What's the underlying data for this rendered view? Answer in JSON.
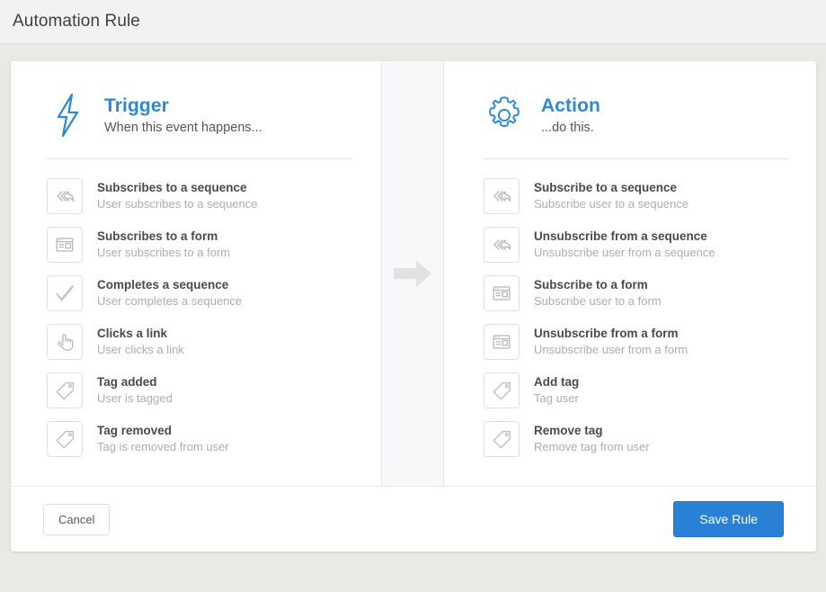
{
  "header": {
    "title": "Automation Rule"
  },
  "trigger": {
    "icon": "lightning-bolt-icon",
    "title": "Trigger",
    "subtitle": "When this event happens...",
    "options": [
      {
        "icon": "sequence-icon",
        "title": "Subscribes to a sequence",
        "subtitle": "User subscribes to a sequence"
      },
      {
        "icon": "form-icon",
        "title": "Subscribes to a form",
        "subtitle": "User subscribes to a form"
      },
      {
        "icon": "check-icon",
        "title": "Completes a sequence",
        "subtitle": "User completes a sequence"
      },
      {
        "icon": "pointer-hand-icon",
        "title": "Clicks a link",
        "subtitle": "User clicks a link"
      },
      {
        "icon": "tag-icon",
        "title": "Tag added",
        "subtitle": "User is tagged"
      },
      {
        "icon": "tag-icon",
        "title": "Tag removed",
        "subtitle": "Tag is removed from user"
      }
    ]
  },
  "flow_arrow": {
    "icon": "arrow-right-icon"
  },
  "action": {
    "icon": "gear-icon",
    "title": "Action",
    "subtitle": "...do this.",
    "options": [
      {
        "icon": "sequence-icon",
        "title": "Subscribe to a sequence",
        "subtitle": "Subscribe user to a sequence"
      },
      {
        "icon": "sequence-icon",
        "title": "Unsubscribe from a sequence",
        "subtitle": "Unsubscribe user from a sequence"
      },
      {
        "icon": "form-icon",
        "title": "Subscribe to a form",
        "subtitle": "Subscribe user to a form"
      },
      {
        "icon": "form-icon",
        "title": "Unsubscribe from a form",
        "subtitle": "Unsubscribe user from a form"
      },
      {
        "icon": "tag-icon",
        "title": "Add tag",
        "subtitle": "Tag user"
      },
      {
        "icon": "tag-icon",
        "title": "Remove tag",
        "subtitle": "Remove tag from user"
      }
    ]
  },
  "footer": {
    "cancel_label": "Cancel",
    "save_label": "Save Rule"
  },
  "colors": {
    "accent_blue": "#2b8ad6",
    "save_button": "#2980d4",
    "page_background": "#ebe9e4",
    "header_background": "#f2f2f2",
    "divider_column": "#f8f7f9"
  }
}
